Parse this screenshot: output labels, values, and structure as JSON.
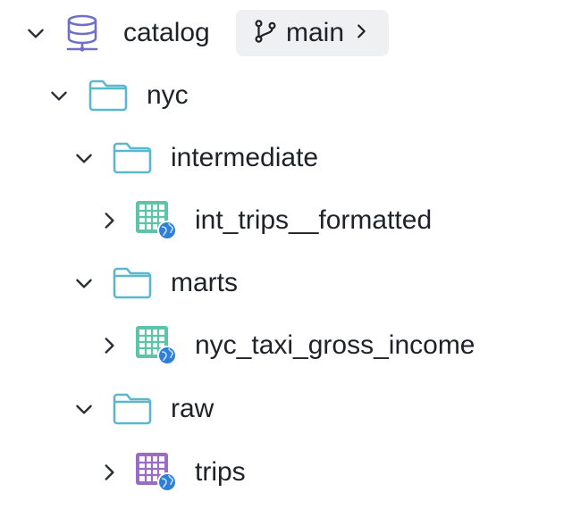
{
  "catalog": {
    "label": "catalog",
    "icon": "database-icon",
    "branch": {
      "label": "main",
      "icon": "git-branch-icon"
    }
  },
  "tree": {
    "nyc": {
      "label": "nyc",
      "icon": "folder-icon"
    },
    "intermediate": {
      "label": "intermediate",
      "icon": "folder-icon"
    },
    "int_trips": {
      "label": "int_trips__formatted",
      "icon": "table-icon",
      "color": "#5ec4a8"
    },
    "marts": {
      "label": "marts",
      "icon": "folder-icon"
    },
    "nyc_taxi": {
      "label": "nyc_taxi_gross_income",
      "icon": "table-icon",
      "color": "#5ec4a8"
    },
    "raw": {
      "label": "raw",
      "icon": "folder-icon"
    },
    "trips": {
      "label": "trips",
      "icon": "table-icon",
      "color": "#9b6cc4"
    }
  },
  "colors": {
    "folder_stroke": "#5bb7cc",
    "database": "#6f6fc9",
    "globe": "#2f7fd6",
    "chevron": "#2a2d33"
  }
}
